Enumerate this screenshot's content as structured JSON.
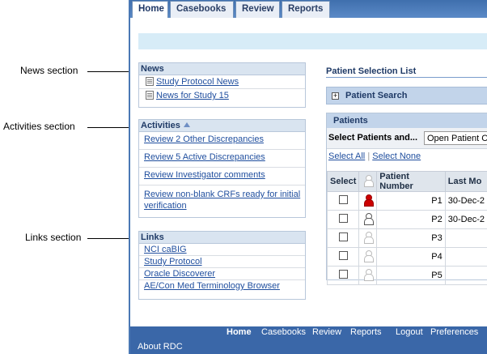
{
  "callouts": {
    "news": "News section",
    "activities": "Activities section",
    "links": "Links section"
  },
  "tabs": [
    "Home",
    "Casebooks",
    "Review",
    "Reports"
  ],
  "news": {
    "title": "News",
    "items": [
      "Study Protocol News",
      "News  for Study 15"
    ]
  },
  "activities": {
    "title": "Activities",
    "items": [
      "Review 2 Other Discrepancies",
      "Review 5 Active Discrepancies",
      "Review Investigator comments",
      "Review non-blank CRFs ready for initial verification"
    ]
  },
  "links": {
    "title": "Links",
    "items": [
      "NCI caBIG",
      "Study Protocol",
      "Oracle Discoverer",
      "AE/Con Med Terminology Browser"
    ]
  },
  "patient_selection": {
    "title": "Patient Selection List",
    "search_label": "Patient Search",
    "patients_label": "Patients",
    "select_label": "Select Patients and...",
    "select_value": "Open Patient Ca",
    "select_all": "Select All",
    "select_none": "Select None",
    "columns": [
      "Select",
      "Patient Number",
      "Last Mo"
    ],
    "rows": [
      {
        "number": "P1",
        "date": "30-Dec-2",
        "icon": "patient-red-icon"
      },
      {
        "number": "P2",
        "date": "30-Dec-2",
        "icon": "patient-icon"
      },
      {
        "number": "P3",
        "date": "",
        "icon": "patient-faint-icon"
      },
      {
        "number": "P4",
        "date": "",
        "icon": "patient-faint-icon"
      },
      {
        "number": "P5",
        "date": "",
        "icon": "patient-faint-icon"
      }
    ]
  },
  "footer": {
    "links": [
      "Home",
      "Casebooks",
      "Review",
      "Reports",
      "Logout",
      "Preferences"
    ],
    "about": "About RDC"
  }
}
